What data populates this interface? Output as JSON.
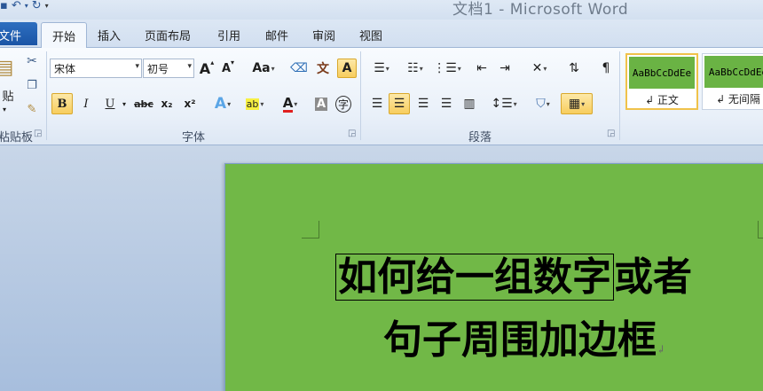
{
  "window": {
    "title": "文档1 - Microsoft Word"
  },
  "tabs": {
    "file": "文件",
    "items": [
      "开始",
      "插入",
      "页面布局",
      "引用",
      "邮件",
      "审阅",
      "视图"
    ]
  },
  "ribbon": {
    "clipboard": {
      "label": "粘贴板",
      "paste": "贴"
    },
    "font": {
      "label": "字体",
      "font_name": "宋体",
      "font_size": "初号",
      "bold": "B",
      "italic": "I",
      "underline": "U",
      "strike": "abc",
      "subscript": "x₂",
      "superscript": "x²",
      "change_case": "Aa",
      "grow": "A",
      "shrink": "A",
      "phonetic": "文",
      "char_border": "A",
      "text_effects": "A",
      "highlight": "ab",
      "font_color": "A",
      "char_shading": "A",
      "enclose": "字"
    },
    "paragraph": {
      "label": "段落"
    },
    "styles": {
      "cards": [
        {
          "sample": "AaBbCcDdEe",
          "name": "↲ 正文"
        },
        {
          "sample": "AaBbCcDdEe",
          "name": "↲ 无间隔"
        }
      ]
    }
  },
  "document": {
    "line1_boxed": "如何给一组数字",
    "line1_rest": "或者",
    "line2": "句子周围加边框",
    "para_mark": "↲"
  },
  "colors": {
    "page_bg": "#71b847",
    "accent": "#1a55a6"
  }
}
